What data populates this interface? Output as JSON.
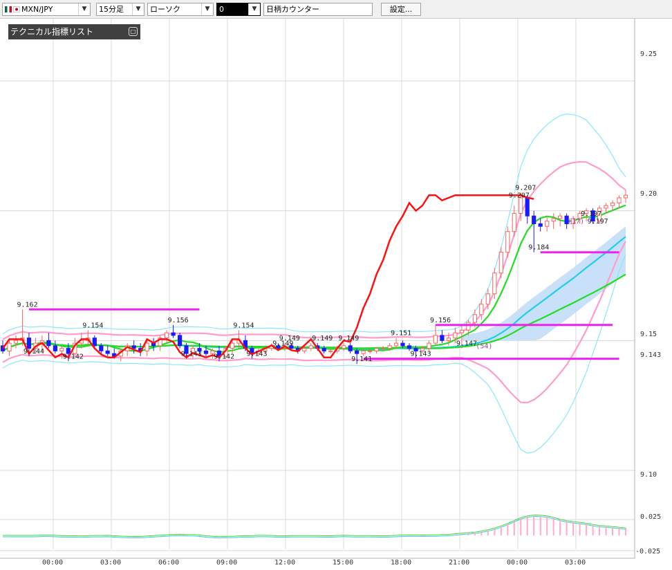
{
  "toolbar": {
    "symbol": "MXN/JPY",
    "timeframe": "15分足",
    "chart_style": "ローソク",
    "color_value": "0",
    "counter_label": "日柄カウンター",
    "settings_label": "設定..."
  },
  "panel": {
    "title": "テクニカル指標リスト",
    "toggle_glyph": "□"
  },
  "colors": {
    "up": "#ff6060",
    "down": "#1a1aff",
    "rci": "#ff1010",
    "ma_green": "#22dd22",
    "ma_cyan": "#22ccee",
    "bb_pink": "#ff9ccc",
    "bb_cyan": "#88e8f8",
    "hline": "#ee22ee",
    "cloud": "#c8e0f8"
  },
  "chart_data": {
    "type": "candlestick",
    "price_axis": {
      "min": 9.076,
      "max": 9.274,
      "ticks": [
        9.25,
        9.2,
        9.15,
        9.143,
        9.1
      ]
    },
    "sub_axis": {
      "ticks": [
        0.025,
        -0.025
      ]
    },
    "time_labels": [
      "00:00",
      "03:00",
      "06:00",
      "09:00",
      "12:00",
      "15:00",
      "18:00",
      "21:00",
      "00:00",
      "03:00"
    ],
    "annotations": [
      {
        "text": "9.162",
        "i": 3,
        "v": 9.162
      },
      {
        "text": "9.144",
        "i": 4,
        "v": 9.144
      },
      {
        "text": "9.142",
        "i": 10,
        "v": 9.142
      },
      {
        "text": "9.154",
        "i": 13,
        "v": 9.154
      },
      {
        "text": "9.156",
        "i": 26,
        "v": 9.156
      },
      {
        "text": "9.143",
        "i": 28,
        "v": 9.143
      },
      {
        "text": "9.142",
        "i": 33,
        "v": 9.142
      },
      {
        "text": "9.154",
        "i": 36,
        "v": 9.154
      },
      {
        "text": "9.143",
        "i": 38,
        "v": 9.143
      },
      {
        "text": "9.149",
        "i": 43,
        "v": 9.149
      },
      {
        "text": "9.149",
        "i": 42,
        "v": 9.147
      },
      {
        "text": "9.149",
        "i": 48,
        "v": 9.149
      },
      {
        "text": "9.149",
        "i": 52,
        "v": 9.149
      },
      {
        "text": "9.141",
        "i": 54,
        "v": 9.141
      },
      {
        "text": "9.151",
        "i": 60,
        "v": 9.151
      },
      {
        "text": "9.143",
        "i": 63,
        "v": 9.143
      },
      {
        "text": "9.156",
        "i": 66,
        "v": 9.156
      },
      {
        "text": "9.147",
        "i": 70,
        "v": 9.147
      },
      {
        "text": "(54)",
        "i": 73,
        "v": 9.146
      },
      {
        "text": "9.207",
        "i": 79,
        "v": 9.207
      },
      {
        "text": "9.207",
        "i": 78,
        "v": 9.204
      },
      {
        "text": "9.184",
        "i": 81,
        "v": 9.184
      },
      {
        "text": "9.197",
        "i": 89,
        "v": 9.197
      },
      {
        "text": "(17)",
        "i": 87,
        "v": 9.194
      },
      {
        "text": "9.197",
        "i": 90,
        "v": 9.194
      }
    ],
    "hlines": [
      {
        "v": 9.162,
        "from": 4,
        "to": 30
      },
      {
        "v": 9.156,
        "from": 66,
        "to": 93
      },
      {
        "v": 9.143,
        "from": 55,
        "to": 94
      },
      {
        "v": 9.184,
        "from": 82,
        "to": 94
      }
    ],
    "ohlc": [
      [
        9.148,
        9.15,
        9.145,
        9.146
      ],
      [
        9.146,
        9.151,
        9.144,
        9.149
      ],
      [
        9.149,
        9.152,
        9.147,
        9.15
      ],
      [
        9.15,
        9.162,
        9.148,
        9.151
      ],
      [
        9.151,
        9.153,
        9.144,
        9.147
      ],
      [
        9.147,
        9.151,
        9.145,
        9.149
      ],
      [
        9.149,
        9.152,
        9.146,
        9.15
      ],
      [
        9.15,
        9.153,
        9.147,
        9.148
      ],
      [
        9.148,
        9.15,
        9.145,
        9.146
      ],
      [
        9.146,
        9.148,
        9.143,
        9.147
      ],
      [
        9.147,
        9.149,
        9.142,
        9.145
      ],
      [
        9.145,
        9.151,
        9.144,
        9.149
      ],
      [
        9.149,
        9.153,
        9.147,
        9.15
      ],
      [
        9.15,
        9.154,
        9.148,
        9.151
      ],
      [
        9.151,
        9.152,
        9.147,
        9.148
      ],
      [
        9.148,
        9.149,
        9.145,
        9.146
      ],
      [
        9.146,
        9.148,
        9.144,
        9.145
      ],
      [
        9.145,
        9.147,
        9.143,
        9.144
      ],
      [
        9.144,
        9.147,
        9.142,
        9.146
      ],
      [
        9.146,
        9.149,
        9.144,
        9.148
      ],
      [
        9.148,
        9.15,
        9.145,
        9.147
      ],
      [
        9.147,
        9.149,
        9.144,
        9.146
      ],
      [
        9.146,
        9.15,
        9.144,
        9.149
      ],
      [
        9.149,
        9.151,
        9.146,
        9.148
      ],
      [
        9.148,
        9.152,
        9.146,
        9.151
      ],
      [
        9.151,
        9.154,
        9.149,
        9.153
      ],
      [
        9.153,
        9.156,
        9.151,
        9.152
      ],
      [
        9.152,
        9.153,
        9.147,
        9.148
      ],
      [
        9.148,
        9.149,
        9.143,
        9.145
      ],
      [
        9.145,
        9.148,
        9.143,
        9.147
      ],
      [
        9.147,
        9.149,
        9.144,
        9.146
      ],
      [
        9.146,
        9.148,
        9.144,
        9.145
      ],
      [
        9.145,
        9.147,
        9.143,
        9.146
      ],
      [
        9.146,
        9.148,
        9.142,
        9.144
      ],
      [
        9.144,
        9.148,
        9.143,
        9.147
      ],
      [
        9.147,
        9.15,
        9.145,
        9.149
      ],
      [
        9.149,
        9.154,
        9.147,
        9.15
      ],
      [
        9.15,
        9.152,
        9.146,
        9.147
      ],
      [
        9.147,
        9.148,
        9.143,
        9.145
      ],
      [
        9.145,
        9.147,
        9.144,
        9.146
      ],
      [
        9.146,
        9.148,
        9.145,
        9.147
      ],
      [
        9.147,
        9.149,
        9.146,
        9.148
      ],
      [
        9.148,
        9.149,
        9.146,
        9.147
      ],
      [
        9.147,
        9.149,
        9.146,
        9.148
      ],
      [
        9.148,
        9.149,
        9.146,
        9.147
      ],
      [
        9.147,
        9.148,
        9.145,
        9.146
      ],
      [
        9.146,
        9.148,
        9.145,
        9.147
      ],
      [
        9.147,
        9.149,
        9.146,
        9.148
      ],
      [
        9.148,
        9.149,
        9.146,
        9.147
      ],
      [
        9.147,
        9.148,
        9.145,
        9.146
      ],
      [
        9.146,
        9.147,
        9.145,
        9.146
      ],
      [
        9.146,
        9.148,
        9.145,
        9.147
      ],
      [
        9.147,
        9.149,
        9.146,
        9.148
      ],
      [
        9.148,
        9.149,
        9.145,
        9.146
      ],
      [
        9.146,
        9.147,
        9.141,
        9.145
      ],
      [
        9.145,
        9.147,
        9.144,
        9.146
      ],
      [
        9.146,
        9.147,
        9.145,
        9.146
      ],
      [
        9.146,
        9.147,
        9.145,
        9.147
      ],
      [
        9.147,
        9.148,
        9.146,
        9.147
      ],
      [
        9.147,
        9.149,
        9.146,
        9.148
      ],
      [
        9.148,
        9.151,
        9.147,
        9.149
      ],
      [
        9.149,
        9.15,
        9.147,
        9.148
      ],
      [
        9.148,
        9.149,
        9.146,
        9.147
      ],
      [
        9.147,
        9.148,
        9.143,
        9.146
      ],
      [
        9.146,
        9.148,
        9.145,
        9.147
      ],
      [
        9.147,
        9.15,
        9.146,
        9.149
      ],
      [
        9.149,
        9.156,
        9.148,
        9.152
      ],
      [
        9.152,
        9.154,
        9.149,
        9.15
      ],
      [
        9.15,
        9.153,
        9.148,
        9.151
      ],
      [
        9.151,
        9.155,
        9.149,
        9.153
      ],
      [
        9.153,
        9.156,
        9.147,
        9.154
      ],
      [
        9.154,
        9.158,
        9.152,
        9.157
      ],
      [
        9.157,
        9.162,
        9.155,
        9.16
      ],
      [
        9.16,
        9.166,
        9.158,
        9.164
      ],
      [
        9.164,
        9.17,
        9.162,
        9.168
      ],
      [
        9.168,
        9.178,
        9.166,
        9.176
      ],
      [
        9.176,
        9.186,
        9.174,
        9.184
      ],
      [
        9.184,
        9.194,
        9.182,
        9.192
      ],
      [
        9.192,
        9.202,
        9.19,
        9.199
      ],
      [
        9.199,
        9.207,
        9.196,
        9.205
      ],
      [
        9.205,
        9.206,
        9.195,
        9.198
      ],
      [
        9.198,
        9.2,
        9.184,
        9.195
      ],
      [
        9.195,
        9.197,
        9.192,
        9.194
      ],
      [
        9.194,
        9.198,
        9.192,
        9.196
      ],
      [
        9.196,
        9.199,
        9.193,
        9.197
      ],
      [
        9.197,
        9.199,
        9.194,
        9.198
      ],
      [
        9.198,
        9.199,
        9.193,
        9.195
      ],
      [
        9.195,
        9.198,
        9.193,
        9.197
      ],
      [
        9.197,
        9.2,
        9.195,
        9.199
      ],
      [
        9.199,
        9.201,
        9.196,
        9.2
      ],
      [
        9.2,
        9.201,
        9.195,
        9.196
      ],
      [
        9.196,
        9.202,
        9.195,
        9.201
      ],
      [
        9.201,
        9.203,
        9.199,
        9.202
      ],
      [
        9.202,
        9.204,
        9.2,
        9.203
      ],
      [
        9.203,
        9.206,
        9.201,
        9.205
      ],
      [
        9.205,
        9.208,
        9.203,
        9.206
      ]
    ]
  }
}
